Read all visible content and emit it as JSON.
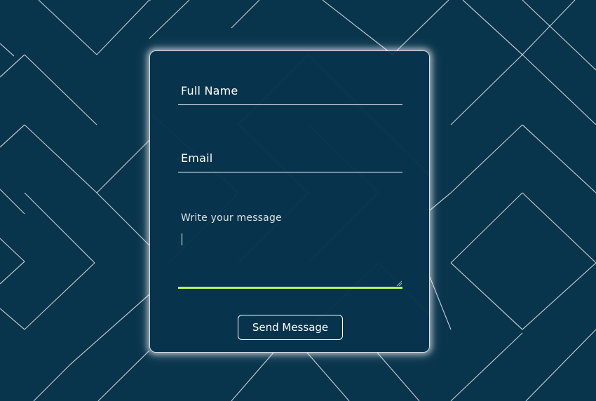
{
  "form": {
    "name_placeholder": "Full Name",
    "email_placeholder": "Email",
    "message_placeholder": "Write your message",
    "send_label": "Send Message"
  },
  "colors": {
    "background": "#08344c",
    "card_background": "#08344c",
    "text": "#ffffff",
    "focus_underline": "#b9f05a",
    "pattern_line": "#ffffff"
  }
}
